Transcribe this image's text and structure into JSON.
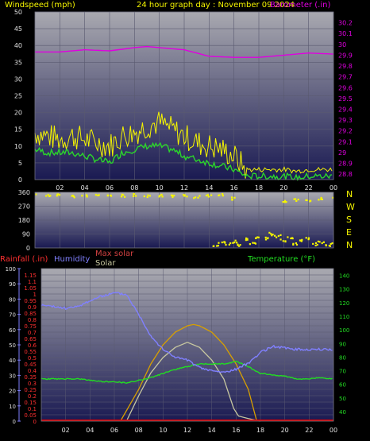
{
  "colors": {
    "background": "#000000",
    "plot_top": "#a9a9b0",
    "plot_bottom": "#1a1a52",
    "grid": "#5a5a70",
    "wind_avg": "#2bd52b",
    "wind_gust": "#f5f500",
    "barometer": "#e000e0",
    "wind_dir": "#f5f500",
    "rain": "#e00000",
    "humidity": "#8080ff",
    "temperature": "#22dd22",
    "max_solar": "#d8a000",
    "solar": "#c8c8a0",
    "tick_text": "#e0e0e0",
    "temp_axis": "#22dd22",
    "rain_axis": "#ff3030",
    "humidity_axis": "#8080ff"
  },
  "header": {
    "title": "24 hour graph day : November 09 2024",
    "wind_label": "Windspeed (mph)",
    "baro_label": "Barometer (.in)"
  },
  "compass": {
    "north": "N",
    "west": "W",
    "south": "S",
    "east": "E"
  },
  "bottom_labels": {
    "rain": "Rainfall (.in)",
    "humidity": "Humidity",
    "max_solar": "Max solar",
    "solar": "Solar",
    "temperature": "Temperature (°F)"
  },
  "chart_data": [
    {
      "type": "line",
      "name": "wind_and_barometer",
      "x_ticks": [
        "02",
        "04",
        "06",
        "08",
        "10",
        "12",
        "14",
        "16",
        "18",
        "20",
        "22",
        "00"
      ],
      "y_left_ticks": [
        "0",
        "5",
        "10",
        "15",
        "20",
        "25",
        "30",
        "35",
        "40",
        "45",
        "50"
      ],
      "y_left_range": [
        0,
        50
      ],
      "y_right_ticks": [
        "28.8",
        "28.9",
        "29",
        "29.1",
        "29.2",
        "29.3",
        "29.4",
        "29.5",
        "29.6",
        "29.7",
        "29.8",
        "29.9",
        "30",
        "30.1",
        "30.2"
      ],
      "y_right_range": [
        28.75,
        30.3
      ],
      "x_range_hours": [
        0,
        24
      ],
      "series": [
        {
          "name": "Windspeed",
          "axis": "left",
          "x": [
            0,
            1,
            2,
            3,
            4,
            5,
            6,
            7,
            8,
            9,
            10,
            11,
            12,
            13,
            14,
            15,
            16,
            17,
            18,
            19,
            20,
            21,
            22,
            23,
            24
          ],
          "values": [
            9,
            8,
            8,
            8,
            7,
            6,
            5,
            8,
            9,
            10,
            10,
            9,
            7,
            6,
            5,
            4,
            3,
            1,
            1,
            1,
            1,
            0.5,
            1,
            1,
            1
          ]
        },
        {
          "name": "Gust",
          "axis": "left",
          "x": [
            0,
            1,
            2,
            3,
            4,
            5,
            6,
            7,
            8,
            9,
            10,
            11,
            12,
            13,
            14,
            15,
            16,
            17,
            18,
            19,
            20,
            21,
            22,
            23,
            24
          ],
          "values": [
            14,
            13,
            12,
            13,
            12,
            11,
            10,
            13,
            14,
            16,
            17,
            15,
            13,
            11,
            10,
            9,
            7,
            3,
            3,
            3,
            3,
            2.5,
            3,
            3,
            3
          ]
        },
        {
          "name": "Barometer",
          "axis": "right",
          "x": [
            0,
            2,
            4,
            6,
            8,
            9,
            10,
            12,
            14,
            16,
            18,
            20,
            22,
            24
          ],
          "values": [
            29.93,
            29.93,
            29.95,
            29.94,
            29.97,
            29.98,
            29.97,
            29.95,
            29.89,
            29.88,
            29.88,
            29.9,
            29.92,
            29.91
          ]
        }
      ]
    },
    {
      "type": "scatter",
      "name": "wind_direction",
      "y_ticks": [
        "0",
        "90",
        "180",
        "270",
        "360"
      ],
      "y_range": [
        0,
        360
      ],
      "points": [
        [
          0,
          340
        ],
        [
          1,
          338
        ],
        [
          2,
          342
        ],
        [
          3,
          336
        ],
        [
          4,
          340
        ],
        [
          5,
          337
        ],
        [
          6,
          341
        ],
        [
          7,
          339
        ],
        [
          8,
          343
        ],
        [
          9,
          338
        ],
        [
          10,
          340
        ],
        [
          11,
          337
        ],
        [
          12,
          341
        ],
        [
          13,
          330
        ],
        [
          14,
          335
        ],
        [
          15,
          342
        ],
        [
          16,
          320
        ],
        [
          20,
          300
        ],
        [
          21,
          310
        ],
        [
          22,
          305
        ],
        [
          23,
          320
        ],
        [
          24,
          330
        ],
        [
          14.5,
          20
        ],
        [
          15,
          35
        ],
        [
          15.5,
          25
        ],
        [
          16,
          40
        ],
        [
          16.5,
          20
        ],
        [
          17,
          55
        ],
        [
          17.5,
          30
        ],
        [
          18,
          70
        ],
        [
          18.5,
          60
        ],
        [
          19,
          90
        ],
        [
          19.5,
          75
        ],
        [
          20,
          50
        ],
        [
          20.5,
          65
        ],
        [
          21,
          30
        ],
        [
          21.5,
          45
        ],
        [
          22,
          60
        ],
        [
          22.5,
          25
        ],
        [
          23,
          40
        ],
        [
          23.5,
          15
        ],
        [
          24,
          35
        ]
      ]
    },
    {
      "type": "line",
      "name": "rain_humidity_temperature_solar",
      "x_ticks": [
        "02",
        "04",
        "06",
        "08",
        "10",
        "12",
        "14",
        "16",
        "18",
        "20",
        "22",
        "00"
      ],
      "humidity_ticks": [
        "0",
        "10",
        "20",
        "30",
        "40",
        "50",
        "60",
        "70",
        "80",
        "90",
        "100"
      ],
      "humidity_range": [
        0,
        100
      ],
      "rain_ticks": [
        "0",
        "0.05",
        "0.1",
        "0.15",
        "0.2",
        "0.25",
        "0.3",
        "0.35",
        "0.4",
        "0.45",
        "0.5",
        "0.55",
        "0.6",
        "0.65",
        "0.7",
        "0.75",
        "0.8",
        "0.85",
        "0.9",
        "0.95",
        "1",
        "1.05",
        "1.1",
        "1.15"
      ],
      "rain_range": [
        0,
        1.2
      ],
      "temp_ticks": [
        "40",
        "50",
        "60",
        "70",
        "80",
        "90",
        "100",
        "110",
        "120",
        "130",
        "140"
      ],
      "temp_range": [
        33,
        145
      ],
      "series": [
        {
          "name": "Humidity",
          "x": [
            0,
            1,
            2,
            3,
            4,
            5,
            6,
            7,
            8,
            9,
            10,
            11,
            12,
            13,
            14,
            15,
            16,
            17,
            18,
            19,
            20,
            21,
            22,
            23,
            24
          ],
          "values": [
            76,
            75,
            74,
            75,
            79,
            82,
            84,
            83,
            70,
            56,
            47,
            42,
            40,
            35,
            33,
            32,
            34,
            38,
            45,
            49,
            48,
            47,
            47,
            47,
            47
          ]
        },
        {
          "name": "Temperature",
          "x": [
            0,
            1,
            2,
            3,
            4,
            5,
            6,
            7,
            8,
            9,
            10,
            11,
            12,
            13,
            14,
            15,
            16,
            17,
            18,
            19,
            20,
            21,
            22,
            23,
            24
          ],
          "values": [
            64,
            64,
            64,
            64,
            63,
            62,
            62,
            61,
            63,
            65,
            68,
            71,
            73,
            75,
            75,
            75,
            77,
            73,
            68,
            67,
            66,
            64,
            64,
            65,
            64
          ]
        },
        {
          "name": "Rainfall",
          "x": [
            0,
            24
          ],
          "values": [
            0,
            0
          ]
        },
        {
          "name": "Max solar",
          "x": [
            6.5,
            8,
            9,
            10,
            11,
            12,
            12.5,
            13,
            14,
            15,
            16,
            17,
            17.7
          ],
          "values": [
            0,
            0.25,
            0.45,
            0.6,
            0.7,
            0.75,
            0.76,
            0.75,
            0.7,
            0.6,
            0.45,
            0.25,
            0
          ]
        },
        {
          "name": "Solar",
          "x": [
            7,
            8,
            9,
            10,
            11,
            12,
            13,
            14,
            15,
            15.8,
            16.2,
            17,
            18
          ],
          "values": [
            0,
            0.2,
            0.38,
            0.5,
            0.58,
            0.62,
            0.58,
            0.48,
            0.33,
            0.1,
            0.04,
            0.02,
            0
          ]
        }
      ]
    }
  ]
}
